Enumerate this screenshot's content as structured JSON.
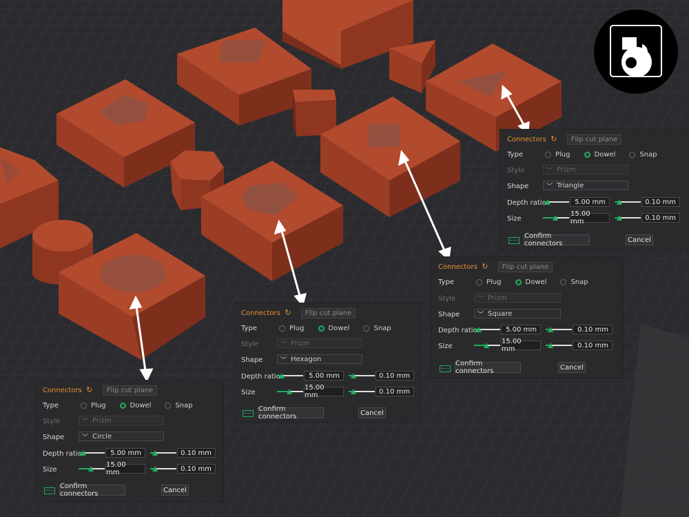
{
  "panel_common": {
    "title": "Connectors",
    "reset_icon": "↻",
    "flip_label": "Flip cut plane",
    "type_label": "Type",
    "type_options": [
      "Plug",
      "Dowel",
      "Snap"
    ],
    "selected_type": "Dowel",
    "style_label": "Style",
    "style_value": "Prizm",
    "shape_label": "Shape",
    "depth_label": "Depth ratio",
    "size_label": "Size",
    "depth_value": "5.00  mm",
    "depth_tol": "0.10  mm",
    "size_value": "15.00  mm",
    "size_tol": "0.10  mm",
    "confirm_label": "Confirm connectors",
    "cancel_label": "Cancel"
  },
  "panels": [
    {
      "id": "circle",
      "shape": "Circle"
    },
    {
      "id": "hexagon",
      "shape": "Hexagon"
    },
    {
      "id": "square",
      "shape": "Square"
    },
    {
      "id": "triangle",
      "shape": "Triangle"
    }
  ],
  "colors": {
    "part": "#b24a2e",
    "accent": "#e8902f",
    "slider_green": "#1fae5e",
    "bed": "#2b2b2f"
  },
  "icons": [
    "reset-icon",
    "chevron-down-icon",
    "keyboard-icon",
    "logo-icon"
  ]
}
